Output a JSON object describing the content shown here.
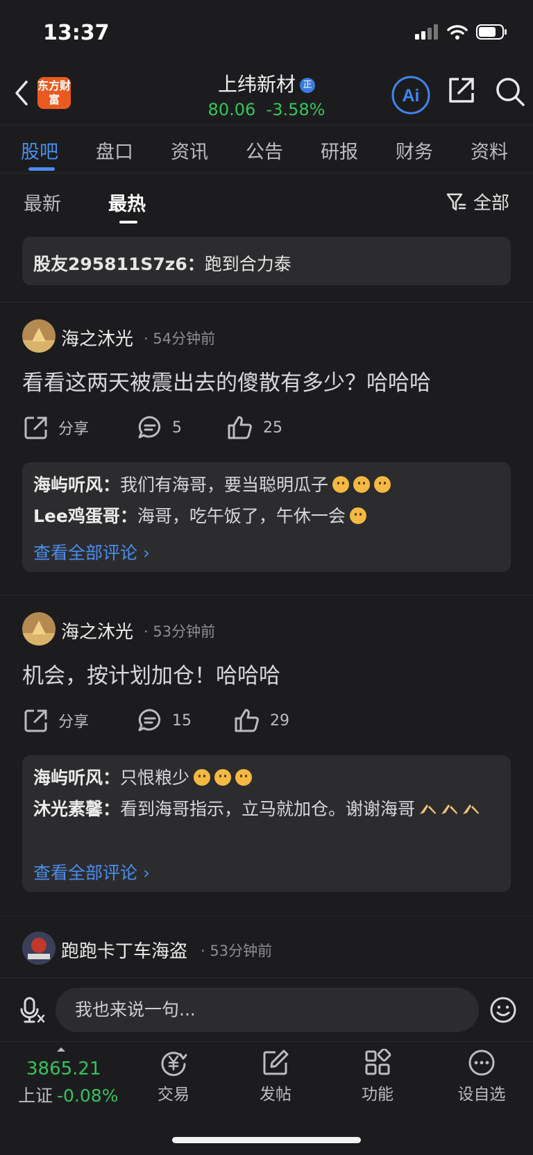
{
  "status_bar": {
    "time": "13:37"
  },
  "header": {
    "brand_logo": "东方财富",
    "stock_name": "上纬新材",
    "verified_badge": "正",
    "price": "80.06",
    "change": "-3.58%",
    "ai_label": "Ai"
  },
  "tabs": [
    "股吧",
    "盘口",
    "资讯",
    "公告",
    "研报",
    "财务",
    "资料"
  ],
  "sort": {
    "latest": "最新",
    "hottest": "最热",
    "filter": "全部"
  },
  "pinned": {
    "author": "股友295811S7z6：",
    "text": "跑到合力泰"
  },
  "posts": [
    {
      "author": "海之沐光",
      "time": "· 54分钟前",
      "content": "看看这两天被震出去的傻散有多少？哈哈哈",
      "share_label": "分享",
      "comment_count": "5",
      "like_count": "25",
      "comments": [
        {
          "author": "海屿听风：",
          "text": "我们有海哥，要当聪明瓜子"
        },
        {
          "author": "Lee鸡蛋哥：",
          "text": "海哥，吃午饭了，午休一会"
        }
      ],
      "view_all": "查看全部评论 ›"
    },
    {
      "author": "海之沐光",
      "time": "· 53分钟前",
      "content": "机会，按计划加仓！哈哈哈",
      "share_label": "分享",
      "comment_count": "15",
      "like_count": "29",
      "comments": [
        {
          "author": "海屿听风：",
          "text": "只恨粮少"
        },
        {
          "author": "沐光素馨：",
          "text": "看到海哥指示，立马就加仓。谢谢海哥"
        }
      ],
      "view_all": "查看全部评论 ›"
    },
    {
      "author": "跑跑卡丁车海盗",
      "time": "· 53分钟前"
    }
  ],
  "input": {
    "placeholder": "我也来说一句..."
  },
  "bottom_bar": {
    "index_value": "3865.21",
    "index_name": "上证",
    "index_change": "-0.08%",
    "items": [
      "交易",
      "发帖",
      "功能",
      "设自选"
    ]
  },
  "colors": {
    "accent_blue": "#4a8ef0",
    "down_green": "#36c45c",
    "brand_orange": "#ea5a1e",
    "background": "#1c1c1e",
    "card": "#2c2c2e"
  }
}
